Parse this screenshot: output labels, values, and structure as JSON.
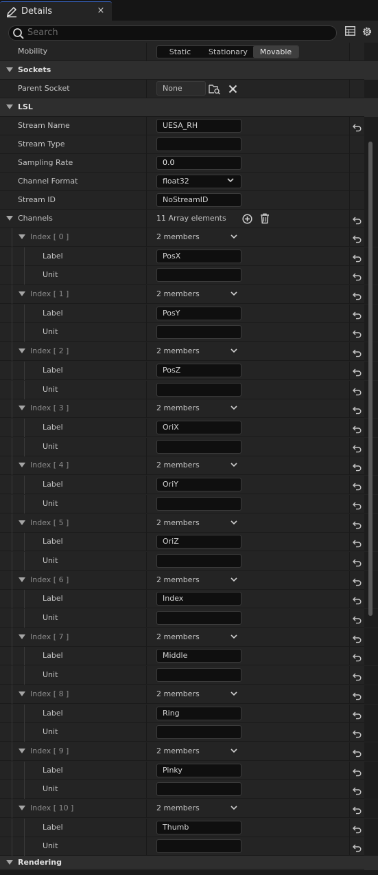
{
  "tab": {
    "title": "Details",
    "close": "×"
  },
  "search": {
    "placeholder": "Search"
  },
  "mobility": {
    "label": "Mobility",
    "options": [
      "Static",
      "Stationary",
      "Movable"
    ],
    "selected": "Movable"
  },
  "sockets": {
    "title": "Sockets",
    "parent_socket_label": "Parent Socket",
    "parent_socket_value": "None"
  },
  "lsl": {
    "title": "LSL",
    "stream_name": {
      "label": "Stream Name",
      "value": "UESA_RH"
    },
    "stream_type": {
      "label": "Stream Type",
      "value": ""
    },
    "sampling_rate": {
      "label": "Sampling Rate",
      "value": "0.0"
    },
    "channel_format": {
      "label": "Channel Format",
      "value": "float32"
    },
    "stream_id": {
      "label": "Stream ID",
      "value": "NoStreamID"
    },
    "channels": {
      "label": "Channels",
      "count_text": "11 Array elements",
      "label_field": "Label",
      "unit_field": "Unit",
      "items": [
        {
          "index": "Index [ 0 ]",
          "members": "2 members",
          "label": "PosX",
          "unit": ""
        },
        {
          "index": "Index [ 1 ]",
          "members": "2 members",
          "label": "PosY",
          "unit": ""
        },
        {
          "index": "Index [ 2 ]",
          "members": "2 members",
          "label": "PosZ",
          "unit": ""
        },
        {
          "index": "Index [ 3 ]",
          "members": "2 members",
          "label": "OriX",
          "unit": ""
        },
        {
          "index": "Index [ 4 ]",
          "members": "2 members",
          "label": "OriY",
          "unit": ""
        },
        {
          "index": "Index [ 5 ]",
          "members": "2 members",
          "label": "OriZ",
          "unit": ""
        },
        {
          "index": "Index [ 6 ]",
          "members": "2 members",
          "label": "Index",
          "unit": ""
        },
        {
          "index": "Index [ 7 ]",
          "members": "2 members",
          "label": "Middle",
          "unit": ""
        },
        {
          "index": "Index [ 8 ]",
          "members": "2 members",
          "label": "Ring",
          "unit": ""
        },
        {
          "index": "Index [ 9 ]",
          "members": "2 members",
          "label": "Pinky",
          "unit": ""
        },
        {
          "index": "Index [ 10 ]",
          "members": "2 members",
          "label": "Thumb",
          "unit": ""
        }
      ]
    }
  },
  "rendering": {
    "title": "Rendering"
  },
  "colors": {
    "accent": "#3a6ad0",
    "panel": "#242424",
    "category": "#2e2e2e",
    "field": "#0f0f0f"
  },
  "icons": [
    "pencil-icon",
    "close-icon",
    "search-icon",
    "table-view-icon",
    "settings-gear-icon",
    "browse-socket-icon",
    "clear-icon",
    "add-element-icon",
    "delete-all-icon",
    "reset-arrow-icon",
    "chevron-down-icon",
    "collapse-arrow-icon"
  ]
}
